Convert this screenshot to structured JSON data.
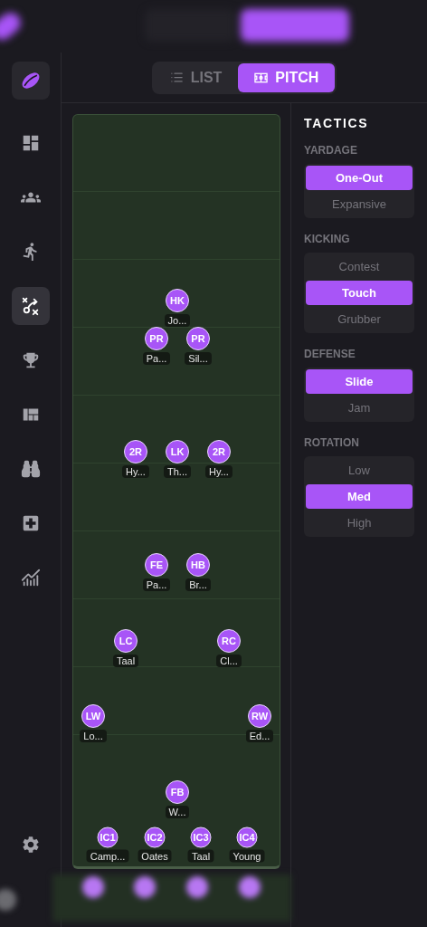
{
  "view_toggle": [
    {
      "label": "LIST",
      "selected": false
    },
    {
      "label": "PITCH",
      "selected": true
    }
  ],
  "sidebar": {
    "items": [
      {
        "selected": false
      },
      {
        "selected": false
      },
      {
        "selected": false
      },
      {
        "selected": true
      },
      {
        "selected": false
      },
      {
        "selected": false
      },
      {
        "selected": false
      },
      {
        "selected": false
      },
      {
        "selected": false
      }
    ]
  },
  "pitch": {
    "players": [
      {
        "position": "HK",
        "name": "Jo..."
      },
      {
        "position": "PR",
        "name": "Pa..."
      },
      {
        "position": "PR",
        "name": "Sil..."
      },
      {
        "position": "2R",
        "name": "Hy..."
      },
      {
        "position": "LK",
        "name": "Th..."
      },
      {
        "position": "2R",
        "name": "Hy..."
      },
      {
        "position": "FE",
        "name": "Pa..."
      },
      {
        "position": "HB",
        "name": "Br..."
      },
      {
        "position": "LC",
        "name": "Taal"
      },
      {
        "position": "RC",
        "name": "Cl..."
      },
      {
        "position": "LW",
        "name": "Lo..."
      },
      {
        "position": "RW",
        "name": "Ed..."
      },
      {
        "position": "FB",
        "name": "W..."
      }
    ],
    "interchange": [
      {
        "position": "IC1",
        "name": "Camp..."
      },
      {
        "position": "IC2",
        "name": "Oates"
      },
      {
        "position": "IC3",
        "name": "Taal"
      },
      {
        "position": "IC4",
        "name": "Young"
      }
    ]
  },
  "tactics": {
    "title": "TACTICS",
    "groups": [
      {
        "label": "YARDAGE",
        "options": [
          {
            "label": "One-Out",
            "selected": true
          },
          {
            "label": "Expansive",
            "selected": false
          }
        ]
      },
      {
        "label": "KICKING",
        "options": [
          {
            "label": "Contest",
            "selected": false
          },
          {
            "label": "Touch",
            "selected": true
          },
          {
            "label": "Grubber",
            "selected": false
          }
        ]
      },
      {
        "label": "DEFENSE",
        "options": [
          {
            "label": "Slide",
            "selected": true
          },
          {
            "label": "Jam",
            "selected": false
          }
        ]
      },
      {
        "label": "ROTATION",
        "options": [
          {
            "label": "Low",
            "selected": false
          },
          {
            "label": "Med",
            "selected": true
          },
          {
            "label": "High",
            "selected": false
          }
        ]
      }
    ]
  }
}
